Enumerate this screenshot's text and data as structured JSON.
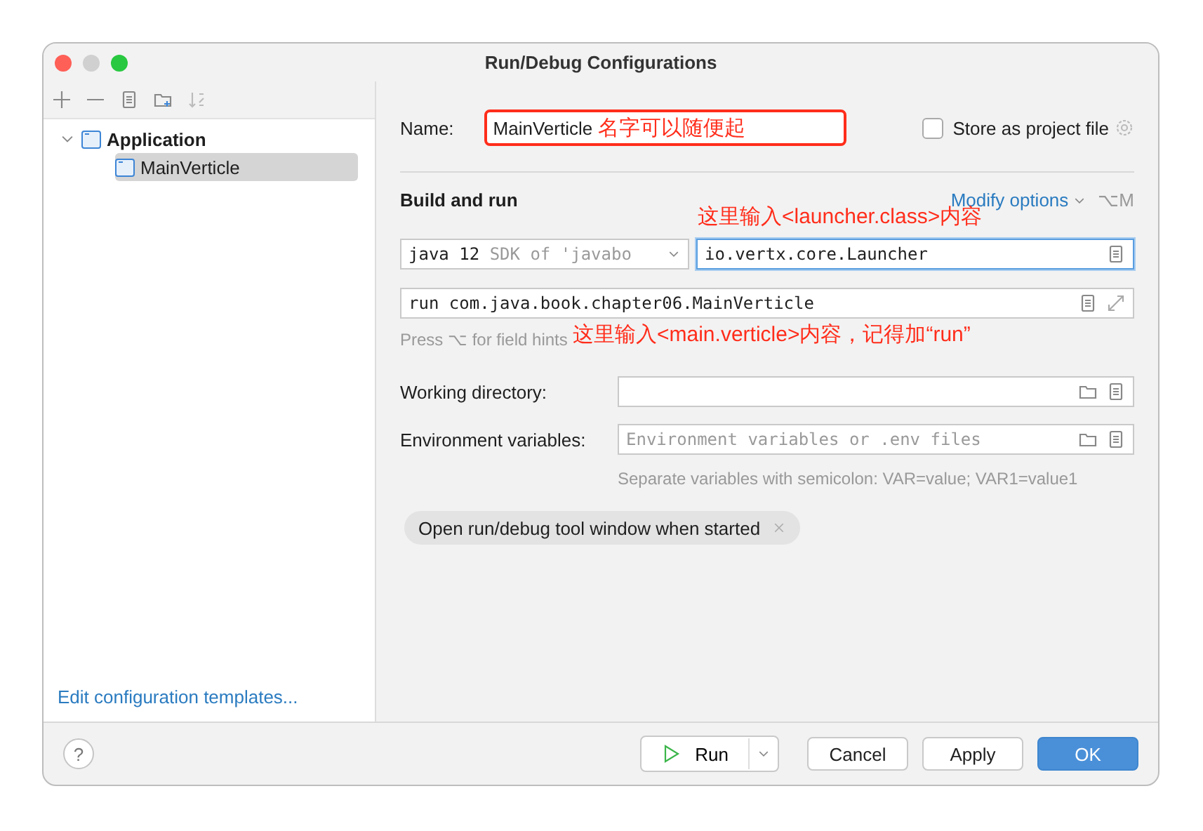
{
  "window": {
    "title": "Run/Debug Configurations"
  },
  "sidebar": {
    "tree": [
      {
        "label": "Application",
        "expanded": true,
        "selected": false,
        "children": [
          {
            "label": "MainVerticle",
            "selected": true
          }
        ]
      }
    ],
    "footer_link": "Edit configuration templates..."
  },
  "form": {
    "name_label": "Name:",
    "name_value": "MainVerticle",
    "name_annotation": "名字可以随便起",
    "store_checkbox": {
      "label": "Store as project file",
      "checked": false
    },
    "section_title": "Build and run",
    "modify_options": "Modify options",
    "modify_shortcut": "⌥M",
    "launcher_annotation": "这里输入<launcher.class>内容",
    "jdk": {
      "value": "java 12",
      "hint": "SDK of 'javabo"
    },
    "main_class": "io.vertx.core.Launcher",
    "program_args": "run com.java.book.chapter06.MainVerticle",
    "field_hint": "Press ⌥ for field hints",
    "args_annotation": "这里输入<main.verticle>内容，记得加“run”",
    "working_directory": {
      "label": "Working directory:"
    },
    "environment": {
      "label": "Environment variables:",
      "placeholder": "Environment variables or .env files",
      "hint": "Separate variables with semicolon: VAR=value; VAR1=value1"
    },
    "option_chip": "Open run/debug tool window when started"
  },
  "help_button": "?",
  "buttons": [
    {
      "label": "Run",
      "kind": "split"
    },
    {
      "label": "Cancel",
      "kind": "normal"
    },
    {
      "label": "Apply",
      "kind": "normal"
    },
    {
      "label": "OK",
      "kind": "primary"
    }
  ]
}
